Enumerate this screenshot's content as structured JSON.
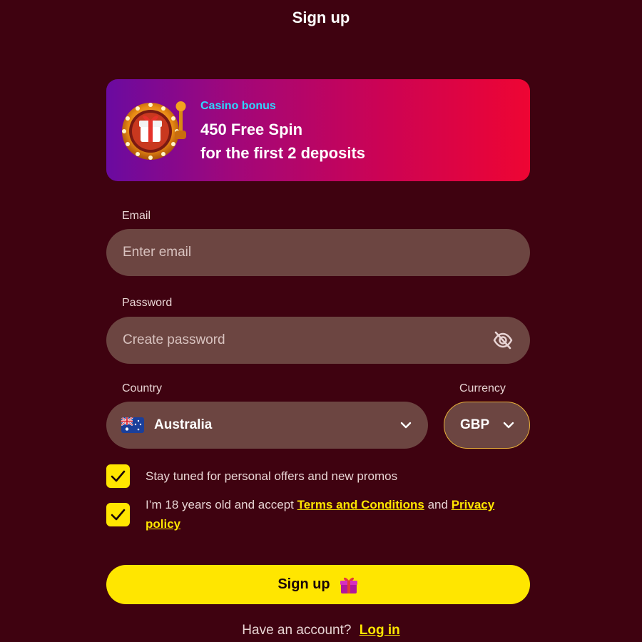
{
  "header": {
    "title": "Sign up"
  },
  "banner": {
    "tag": "Casino bonus",
    "line1": "450 Free Spin",
    "line2": "for the first 2 deposits",
    "icon": "slot-wheel-gift-icon"
  },
  "form": {
    "email": {
      "label": "Email",
      "placeholder": "Enter email",
      "value": ""
    },
    "password": {
      "label": "Password",
      "placeholder": "Create password",
      "value": "",
      "toggle_icon": "eye-off-icon"
    },
    "country": {
      "label": "Country",
      "value": "Australia",
      "flag_icon": "australia-flag-icon"
    },
    "currency": {
      "label": "Currency",
      "value": "GBP"
    },
    "checkboxes": [
      {
        "checked": true,
        "text": "Stay tuned for personal offers and new promos"
      },
      {
        "checked": true,
        "text_before": "I’m 18 years old and accept",
        "link1": "Terms and Conditions",
        "text_mid": "and",
        "link2": "Privacy policy"
      }
    ],
    "submit": {
      "label": "Sign up",
      "icon": "gift-icon"
    }
  },
  "footer": {
    "prompt": "Have an account?",
    "link": "Log in"
  },
  "colors": {
    "background": "#3f0210",
    "accent": "#ffe600",
    "input_bg": "#6c4541"
  }
}
